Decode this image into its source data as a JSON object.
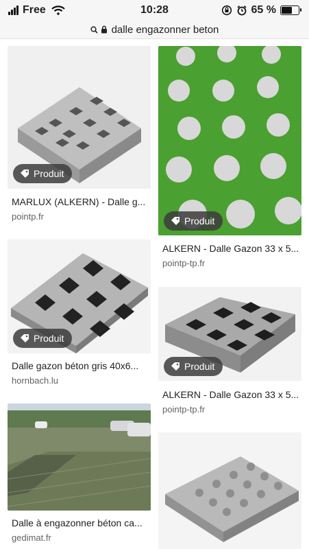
{
  "status": {
    "carrier": "Free",
    "time": "10:28",
    "battery": "65 %",
    "battery_level": 0.65
  },
  "url": {
    "text": "dalle engazonner beton"
  },
  "badge_label": "Produit",
  "results": [
    {
      "title": "MARLUX (ALKERN) - Dalle g...",
      "source": "pointp.fr",
      "has_badge": true
    },
    {
      "title": "ALKERN - Dalle Gazon 33 x 5...",
      "source": "pointp-tp.fr",
      "has_badge": true
    },
    {
      "title": "Dalle gazon béton gris 40x6...",
      "source": "hornbach.lu",
      "has_badge": true
    },
    {
      "title": "ALKERN - Dalle Gazon 33 x 5...",
      "source": "pointp-tp.fr",
      "has_badge": true
    },
    {
      "title": "Dalle à engazonner béton ca...",
      "source": "gedimat.fr",
      "has_badge": false
    },
    {
      "title": "",
      "source": "",
      "has_badge": false
    }
  ]
}
